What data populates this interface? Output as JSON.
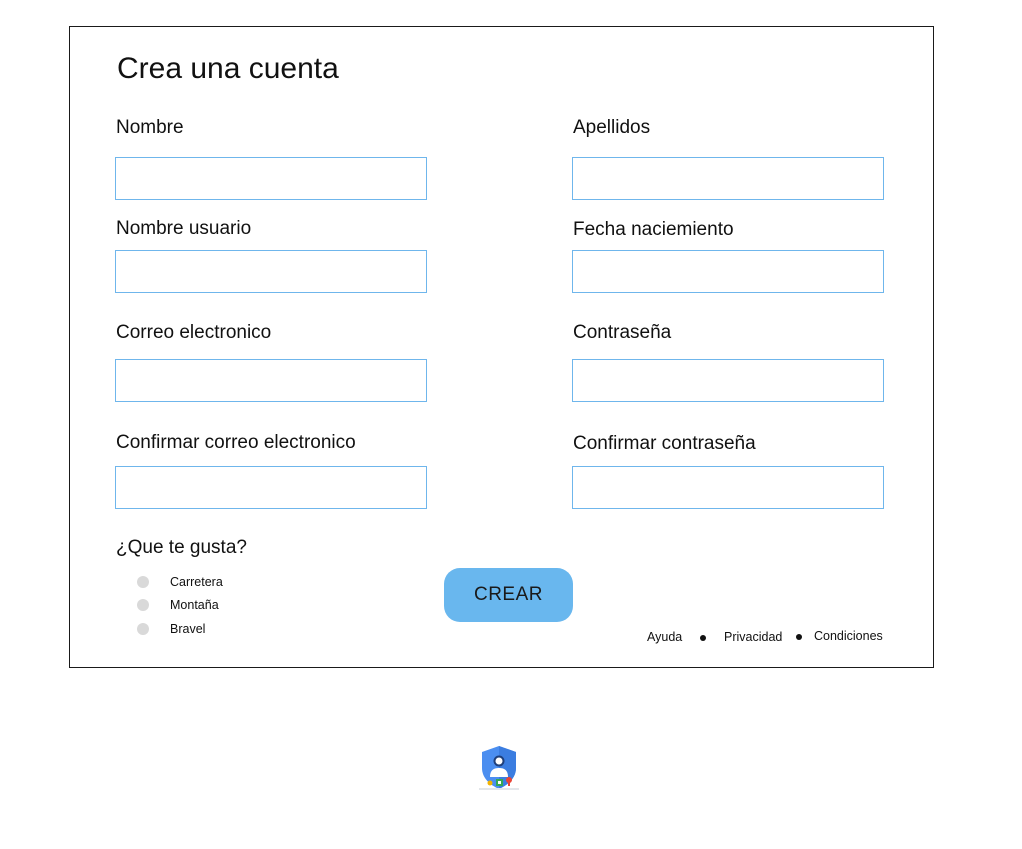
{
  "form": {
    "title": "Crea una cuenta",
    "fields": {
      "nombre": {
        "label": "Nombre",
        "value": "",
        "placeholder": ""
      },
      "apellidos": {
        "label": "Apellidos",
        "value": "",
        "placeholder": ""
      },
      "nombre_usuario": {
        "label": "Nombre usuario",
        "value": "",
        "placeholder": ""
      },
      "fecha_nacimiento": {
        "label": "Fecha naciemiento",
        "value": "",
        "placeholder": ""
      },
      "correo": {
        "label": "Correo electronico",
        "value": "",
        "placeholder": ""
      },
      "contrasena": {
        "label": "Contraseña",
        "value": "",
        "placeholder": ""
      },
      "confirmar_correo": {
        "label": "Confirmar correo electronico",
        "value": "",
        "placeholder": ""
      },
      "confirmar_contrasena": {
        "label": "Confirmar contraseña",
        "value": "",
        "placeholder": ""
      }
    },
    "question": "¿Que te gusta?",
    "options": [
      {
        "label": "Carretera",
        "selected": false
      },
      {
        "label": "Montaña",
        "selected": false
      },
      {
        "label": "Bravel",
        "selected": false
      }
    ],
    "submit_label": "CREAR"
  },
  "footer": {
    "links": [
      "Ayuda",
      "Privacidad",
      "Condiciones"
    ]
  },
  "logo": {
    "icon": "account-shield-icon"
  },
  "colors": {
    "field_border": "#6fb6ec",
    "button": "#69b7ee",
    "radio": "#d9d9d9",
    "card_border": "#1a1a1a"
  }
}
